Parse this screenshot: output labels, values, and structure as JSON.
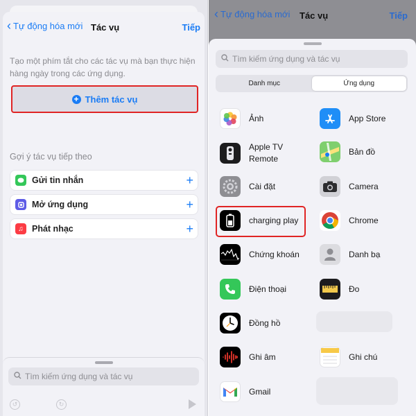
{
  "left": {
    "nav": {
      "back_label": "Tự động hóa mới",
      "title": "Tác vụ",
      "next_label": "Tiếp"
    },
    "description": "Tạo một phím tắt cho các tác vụ mà bạn thực hiện hàng ngày trong các ứng dụng.",
    "add_action_label": "Thêm tác vụ",
    "suggestions_heading": "Gợi ý tác vụ tiếp theo",
    "suggestions": [
      {
        "label": "Gửi tin nhắn",
        "icon": "messages-icon",
        "color": "#34c759"
      },
      {
        "label": "Mở ứng dụng",
        "icon": "open-app-icon",
        "color": "#5e5ce6"
      },
      {
        "label": "Phát nhạc",
        "icon": "music-icon",
        "color": "#fc3c44"
      }
    ],
    "search_placeholder": "Tìm kiếm ứng dụng và tác vụ"
  },
  "right": {
    "nav": {
      "back_label": "Tự động hóa mới",
      "title": "Tác vụ",
      "next_label": "Tiếp"
    },
    "search_placeholder": "Tìm kiếm ứng dụng và tác vụ",
    "segments": {
      "categories": "Danh mục",
      "apps": "Ứng dụng",
      "selected": "Ứng dụng"
    },
    "apps": [
      {
        "name": "Ảnh",
        "icon": "photos-icon"
      },
      {
        "name": "App Store",
        "icon": "app-store-icon"
      },
      {
        "name": "Apple TV Remote",
        "icon": "apple-tv-remote-icon"
      },
      {
        "name": "Bản đồ",
        "icon": "maps-icon"
      },
      {
        "name": "Cài đặt",
        "icon": "settings-icon"
      },
      {
        "name": "Camera",
        "icon": "camera-icon"
      },
      {
        "name": "charging play",
        "icon": "charging-play-icon",
        "highlighted": true
      },
      {
        "name": "Chrome",
        "icon": "chrome-icon"
      },
      {
        "name": "Chứng khoán",
        "icon": "stocks-icon"
      },
      {
        "name": "Danh bạ",
        "icon": "contacts-icon"
      },
      {
        "name": "Điện thoại",
        "icon": "phone-icon"
      },
      {
        "name": "Đo",
        "icon": "measure-icon"
      },
      {
        "name": "Đồng hồ",
        "icon": "clock-icon"
      },
      {
        "name": "Ghi âm",
        "icon": "voice-memos-icon"
      },
      {
        "name": "Ghi chú",
        "icon": "notes-icon"
      },
      {
        "name": "Gmail",
        "icon": "gmail-icon"
      }
    ]
  },
  "colors": {
    "accent": "#1a7cf5",
    "highlight": "#e02424"
  }
}
